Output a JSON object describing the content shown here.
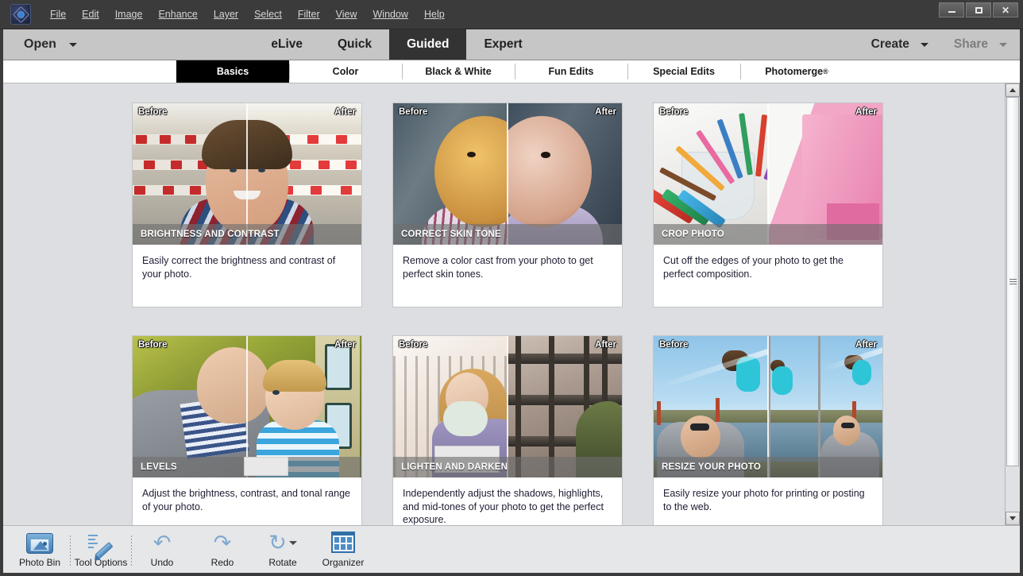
{
  "window": {
    "minimize_label": "minimize",
    "maximize_label": "maximize",
    "close_label": "close"
  },
  "menubar": {
    "logo_name": "photoshop-elements-logo",
    "items": [
      "File",
      "Edit",
      "Image",
      "Enhance",
      "Layer",
      "Select",
      "Filter",
      "View",
      "Window",
      "Help"
    ]
  },
  "modebar": {
    "open_label": "Open",
    "modes": [
      {
        "label": "eLive",
        "active": false
      },
      {
        "label": "Quick",
        "active": false
      },
      {
        "label": "Guided",
        "active": true
      },
      {
        "label": "Expert",
        "active": false
      }
    ],
    "create_label": "Create",
    "share_label": "Share",
    "share_disabled": true
  },
  "subtabs": [
    {
      "label": "Basics",
      "active": true
    },
    {
      "label": "Color",
      "active": false
    },
    {
      "label": "Black & White",
      "active": false
    },
    {
      "label": "Fun Edits",
      "active": false
    },
    {
      "label": "Special Edits",
      "active": false
    },
    {
      "label": "Photomerge",
      "suffix": "®",
      "active": false
    }
  ],
  "cards": [
    {
      "title": "BRIGHTNESS AND CONTRAST",
      "description": "Easily correct the brightness and contrast of your photo.",
      "before_label": "Before",
      "after_label": "After",
      "scene": "boy-at-market"
    },
    {
      "title": "CORRECT SKIN TONE",
      "description": "Remove a color cast from your photo to get perfect skin tones.",
      "before_label": "Before",
      "after_label": "After",
      "scene": "baby-portrait"
    },
    {
      "title": "CROP PHOTO",
      "description": "Cut off the edges of your photo to get the perfect composition.",
      "before_label": "Before",
      "after_label": "After",
      "scene": "colored-pencils"
    },
    {
      "title": "LEVELS",
      "description": "Adjust the brightness, contrast, and tonal range of your photo.",
      "before_label": "Before",
      "after_label": "After",
      "scene": "man-and-toddler"
    },
    {
      "title": "LIGHTEN AND DARKEN",
      "description": "Independently adjust the shadows, highlights, and mid-tones of your photo to get the perfect exposure.",
      "before_label": "Before",
      "after_label": "After",
      "scene": "woman-on-staircase"
    },
    {
      "title": "RESIZE YOUR PHOTO",
      "description": "Easily resize your photo for printing or posting to the web.",
      "before_label": "Before",
      "after_label": "After",
      "scene": "dad-lifting-child-bridge"
    }
  ],
  "taskbar": [
    {
      "label": "Photo Bin",
      "icon": "photo-bin-icon"
    },
    {
      "label": "Tool Options",
      "icon": "tool-options-icon"
    },
    {
      "label": "Undo",
      "icon": "undo-arrow-icon"
    },
    {
      "label": "Redo",
      "icon": "redo-arrow-icon"
    },
    {
      "label": "Rotate",
      "icon": "rotate-icon"
    },
    {
      "label": "Organizer",
      "icon": "organizer-grid-icon"
    }
  ],
  "colors": {
    "menubar_bg": "#3b3b3b",
    "modebar_bg": "#c6c6c6",
    "active_mode_bg": "#333333",
    "active_subtab_bg": "#000000",
    "content_bg": "#dcdee1",
    "taskbar_bg": "#e6e7e9",
    "card_bg": "#ffffff"
  }
}
